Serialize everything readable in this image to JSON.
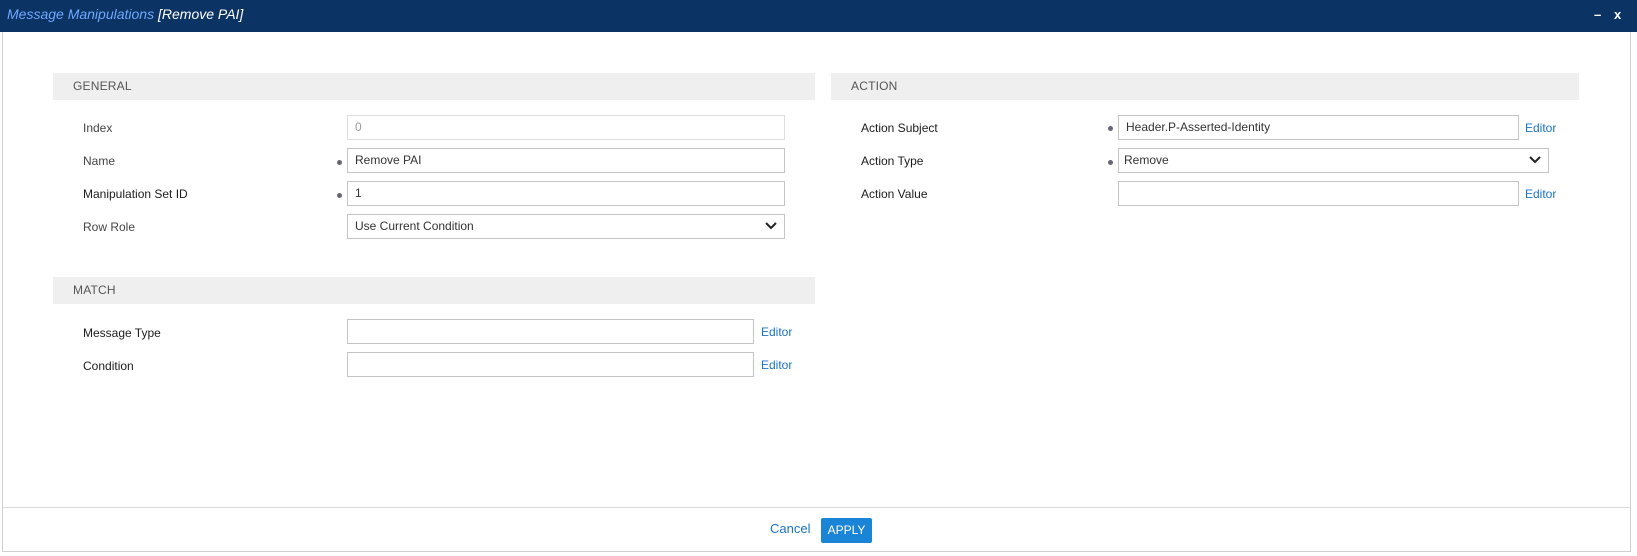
{
  "window": {
    "title": "Message Manipulations",
    "subtitle": "[Remove PAI]",
    "minimize_label": "–",
    "close_label": "x"
  },
  "general": {
    "heading": "GENERAL",
    "index": {
      "label": "Index",
      "value": "0"
    },
    "name": {
      "label": "Name",
      "value": "Remove PAI"
    },
    "manipulation_set_id": {
      "label": "Manipulation Set ID",
      "value": "1"
    },
    "row_role": {
      "label": "Row Role",
      "value": "Use Current Condition"
    }
  },
  "match": {
    "heading": "MATCH",
    "message_type": {
      "label": "Message Type",
      "value": "",
      "editor_label": "Editor"
    },
    "condition": {
      "label": "Condition",
      "value": "",
      "editor_label": "Editor"
    }
  },
  "action": {
    "heading": "ACTION",
    "action_subject": {
      "label": "Action Subject",
      "value": "Header.P-Asserted-Identity",
      "editor_label": "Editor"
    },
    "action_type": {
      "label": "Action Type",
      "value": "Remove"
    },
    "action_value": {
      "label": "Action Value",
      "value": "",
      "editor_label": "Editor"
    }
  },
  "footer": {
    "cancel_label": "Cancel",
    "apply_label": "APPLY"
  },
  "colors": {
    "titlebar": "#0b3363",
    "title_accent": "#6fa8ff",
    "link": "#1a73c8",
    "apply_button": "#1a85d6",
    "panel_header": "#efefef"
  },
  "icons": {
    "dropdown": "chevron-down-icon",
    "required": "required-dot-icon"
  }
}
